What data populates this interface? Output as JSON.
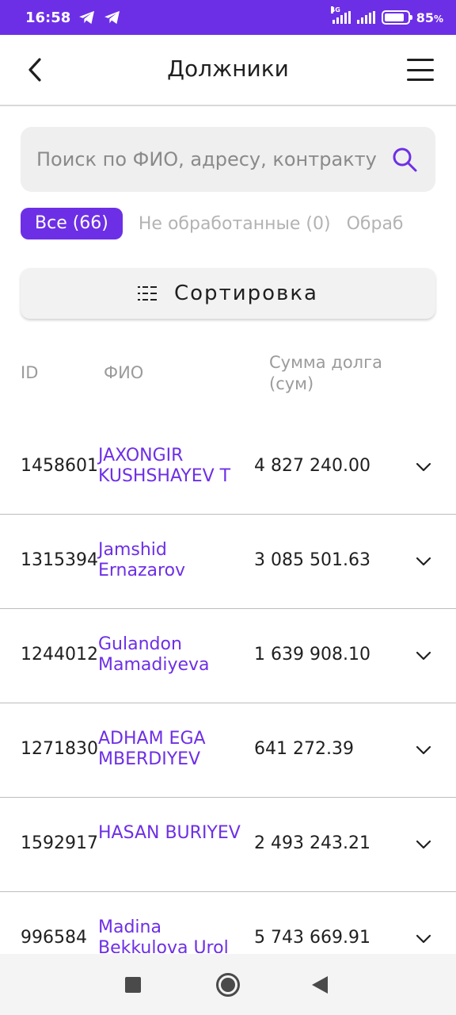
{
  "status_bar": {
    "time": "16:58",
    "network": "4G",
    "battery": "85",
    "battery_unit": "%",
    "battery_level": 0.85
  },
  "header": {
    "title": "Должники",
    "back_icon": "chevron-left-icon",
    "menu_icon": "hamburger-menu-icon"
  },
  "search": {
    "placeholder": "Поиск по ФИО, адресу, контракту",
    "icon": "search-icon"
  },
  "filters": [
    {
      "label": "Все (66)",
      "active": true
    },
    {
      "label": "Не обработанные (0)",
      "active": false
    },
    {
      "label": "Обраб",
      "active": false
    }
  ],
  "sort": {
    "label": "Сортировка",
    "icon": "grid-icon"
  },
  "table": {
    "columns": {
      "id": "ID",
      "name": "ФИО",
      "sum": "Сумма долга (сум)"
    },
    "rows": [
      {
        "id": "1458601",
        "name": "JAXONGIR KUSHSHAYEV T",
        "sum": "4 827 240.00"
      },
      {
        "id": "1315394",
        "name": "Jamshid Ernazarov",
        "sum": "3 085 501.63"
      },
      {
        "id": "1244012",
        "name": "Gulandon Mamadiyeva",
        "sum": "1 639 908.10"
      },
      {
        "id": "1271830",
        "name": "ADHAM EGA MBERDIYEV",
        "sum": "641 272.39"
      },
      {
        "id": "1592917",
        "name": "HASAN BURIYEV",
        "sum": "2 493 243.21"
      },
      {
        "id": "996584",
        "name": "Madina Bekkulova Urol",
        "sum": "5 743 669.91"
      }
    ]
  },
  "colors": {
    "accent": "#6d2fe6",
    "text": "#1f1f1f",
    "muted": "#9b9b9b"
  }
}
